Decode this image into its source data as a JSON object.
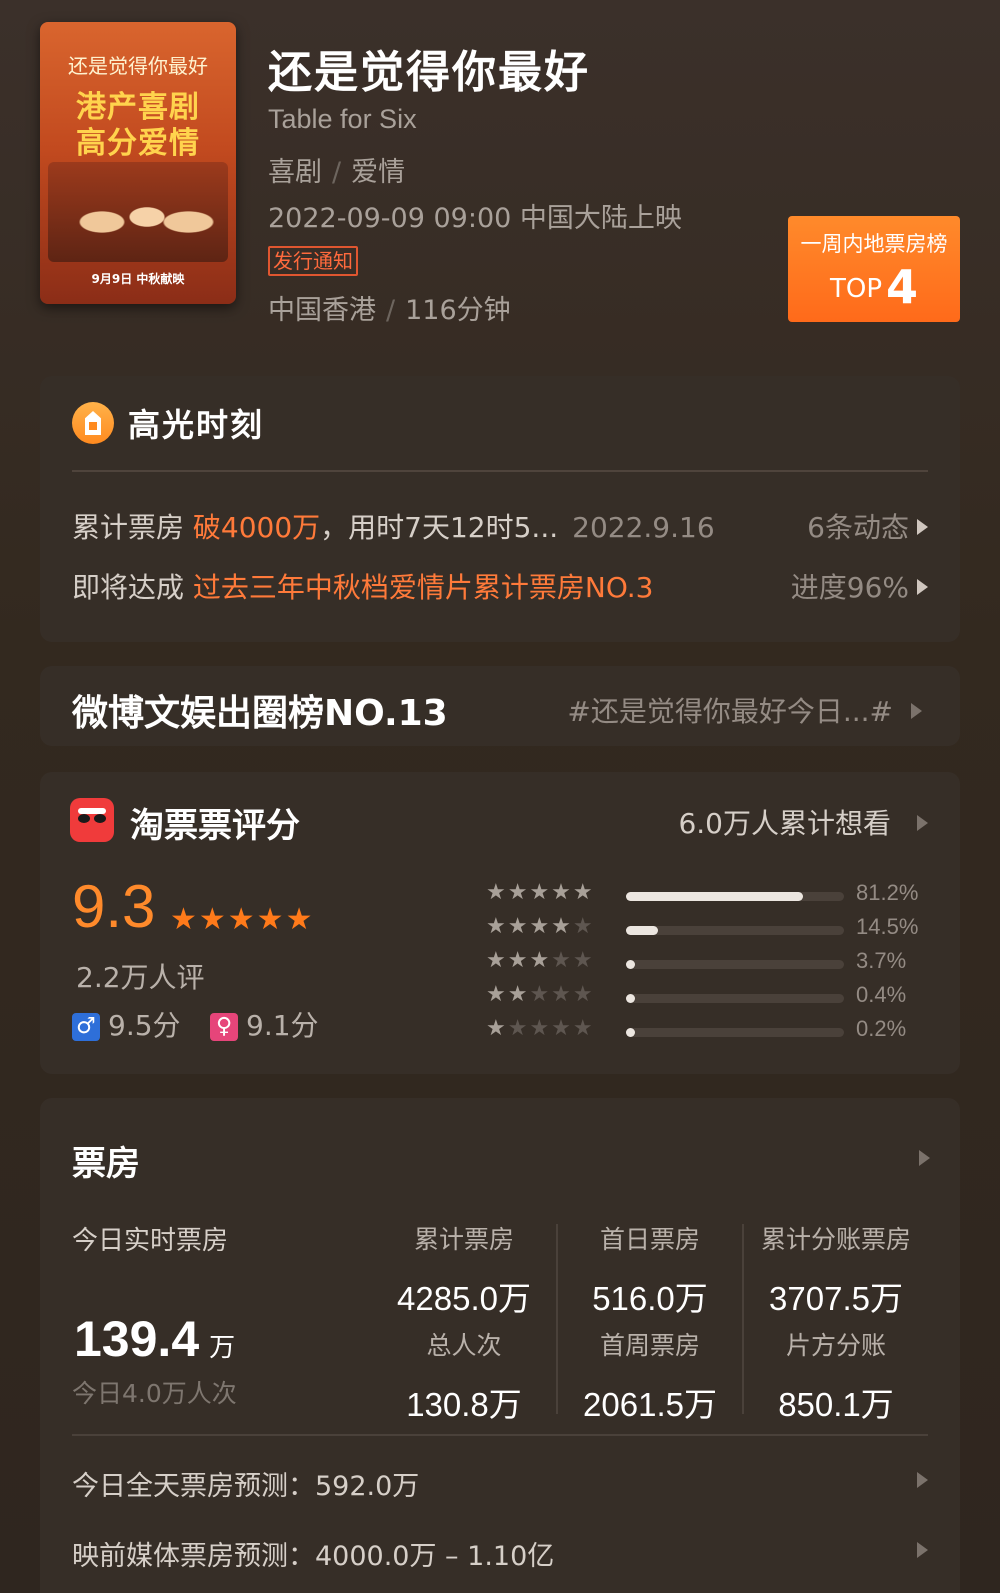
{
  "movie": {
    "title": "还是觉得你最好",
    "subtitle": "Table for Six",
    "genres": [
      "喜剧",
      "爱情"
    ],
    "release": "2022-09-09 09:00 中国大陆上映",
    "notice_badge": "发行通知",
    "region": "中国香港",
    "duration": "116分钟",
    "poster": {
      "small_title": "还是觉得你最好",
      "line1": "港产喜剧",
      "line2": "高分爱情",
      "date_line": "9月9日 中秋献映"
    }
  },
  "rank_badge": {
    "label": "一周内地票房榜",
    "prefix": "TOP",
    "rank": "4"
  },
  "highlight": {
    "title": "高光时刻",
    "row1": {
      "prefix": "累计票房 ",
      "emph": "破4000万",
      "suffix": "，用时7天12时5...",
      "date": "2022.9.16",
      "right": "6条动态"
    },
    "row2": {
      "prefix": "即将达成 ",
      "emph": "过去三年中秋档爱情片累计票房NO.3",
      "right": "进度96%"
    }
  },
  "weibo": {
    "title": "微博文娱出圈榜NO.13",
    "tag": "#还是觉得你最好今日...#"
  },
  "rating": {
    "title": "淘票票评分",
    "want": "6.0万人累计想看",
    "score": "9.3",
    "raters": "2.2万人评",
    "male_score": "9.5分",
    "female_score": "9.1分",
    "distribution": [
      {
        "stars": 5,
        "pct_label": "81.2%",
        "pct": 81.2
      },
      {
        "stars": 4,
        "pct_label": "14.5%",
        "pct": 14.5
      },
      {
        "stars": 3,
        "pct_label": "3.7%",
        "pct": 3.7
      },
      {
        "stars": 2,
        "pct_label": "0.4%",
        "pct": 0.4
      },
      {
        "stars": 1,
        "pct_label": "0.2%",
        "pct": 0.2
      }
    ]
  },
  "boxoffice": {
    "title": "票房",
    "today_label": "今日实时票房",
    "today_value": "139.4",
    "today_unit": "万",
    "today_sub": "今日4.0万人次",
    "stats": [
      {
        "label": "累计票房",
        "value": "4285.0万"
      },
      {
        "label": "首日票房",
        "value": "516.0万"
      },
      {
        "label": "累计分账票房",
        "value": "3707.5万"
      },
      {
        "label": "总人次",
        "value": "130.8万"
      },
      {
        "label": "首周票房",
        "value": "2061.5万"
      },
      {
        "label": "片方分账",
        "value": "850.1万"
      }
    ],
    "forecast_today": "今日全天票房预测：592.0万",
    "forecast_media": "映前媒体票房预测：4000.0万 – 1.10亿"
  }
}
